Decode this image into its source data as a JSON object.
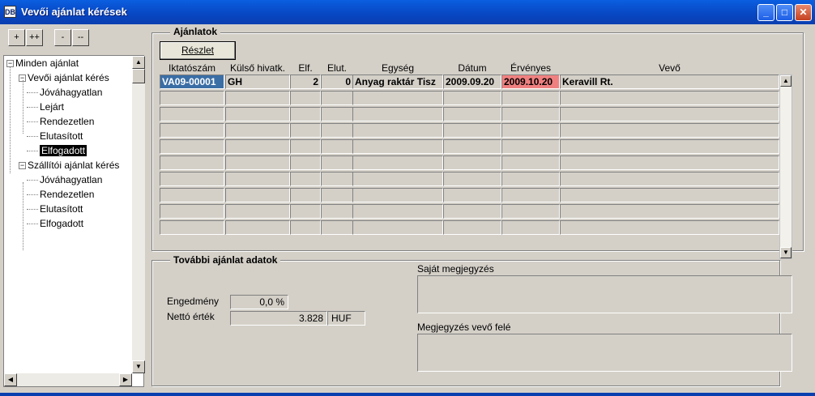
{
  "window": {
    "title": "Vevői ajánlat kérések",
    "app_icon_label": "DB"
  },
  "toolbar": {
    "expand": "+",
    "expand_all": "++",
    "collapse": "-",
    "collapse_all": "--"
  },
  "tree": [
    {
      "label": "Minden ajánlat",
      "level": 0,
      "expanded": true
    },
    {
      "label": "Vevői ajánlat kérés",
      "level": 1,
      "expanded": true
    },
    {
      "label": "Jóváhagyatlan",
      "level": 2
    },
    {
      "label": "Lejárt",
      "level": 2
    },
    {
      "label": "Rendezetlen",
      "level": 2
    },
    {
      "label": "Elutasított",
      "level": 2
    },
    {
      "label": "Elfogadott",
      "level": 2,
      "selected": true
    },
    {
      "label": "Szállítói ajánlat kérés",
      "level": 1,
      "expanded": true
    },
    {
      "label": "Jóváhagyatlan",
      "level": 2
    },
    {
      "label": "Rendezetlen",
      "level": 2
    },
    {
      "label": "Elutasított",
      "level": 2
    },
    {
      "label": "Elfogadott",
      "level": 2
    }
  ],
  "offers": {
    "group_label": "Ajánlatok",
    "detail_button": "Részlet",
    "columns": [
      "Iktatószám",
      "Külső hivatk.",
      "Elf.",
      "Elut.",
      "Egység",
      "Dátum",
      "Érvényes",
      "Vevő"
    ],
    "rows": [
      [
        "VA09-00001",
        "GH",
        "2",
        "0",
        "Anyag raktár Tisz",
        "2009.09.20",
        "2009.10.20",
        "Keravill Rt."
      ]
    ],
    "empty_rows": 9,
    "colors": {
      "id_highlight": "#3a6ea5",
      "valid_highlight": "#f08080"
    }
  },
  "more": {
    "group_label": "További ajánlat adatok",
    "discount_label": "Engedmény",
    "discount_value": "0,0 %",
    "net_label": "Nettó érték",
    "net_value": "3.828",
    "currency": "HUF",
    "own_note_label": "Saját megjegyzés",
    "customer_note_label": "Megjegyzés vevő felé"
  }
}
